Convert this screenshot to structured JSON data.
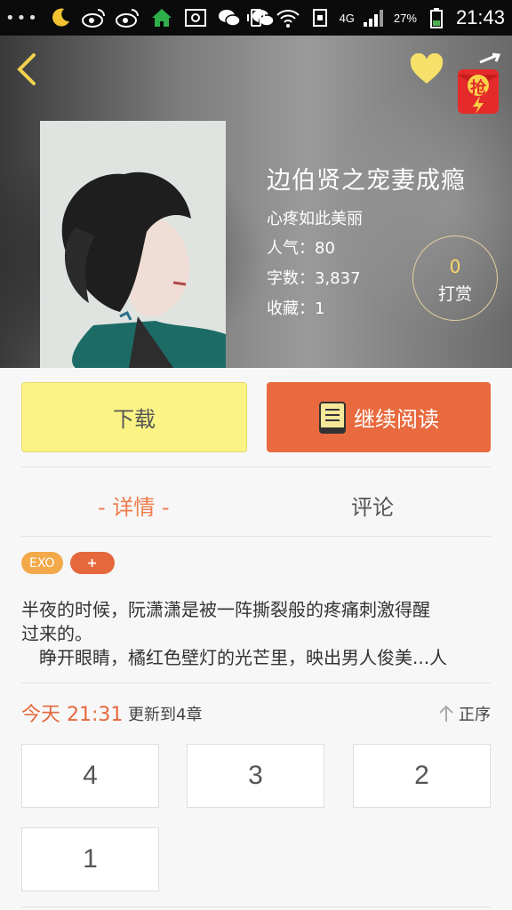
{
  "status_bar": {
    "dots": "•••",
    "network": "4G",
    "battery_percent": "27%",
    "time": "21:43"
  },
  "book": {
    "title": "边伯贤之宠妻成瘾",
    "author": "心疼如此美丽",
    "popularity_label": "人气：",
    "popularity_value": "80",
    "wordcount_label": "字数：",
    "wordcount_value": "3,837",
    "favorites_label": "收藏：",
    "favorites_value": "1"
  },
  "tip": {
    "count": "0",
    "label": "打赏"
  },
  "redpack_label": "抢",
  "actions": {
    "download": "下载",
    "continue_reading": "继续阅读"
  },
  "tabs": {
    "detail": "- 详情 -",
    "comments": "评论"
  },
  "tags": [
    "EXO",
    "+"
  ],
  "synopsis": {
    "line1": "半夜的时候，阮潇潇是被一阵撕裂般的疼痛刺激得醒",
    "line2": "过来的。",
    "line3": "　睁开眼睛，橘红色壁灯的光芒里，映出男人俊美...人"
  },
  "update": {
    "time": "今天 21:31",
    "text": "更新到4章",
    "sort_label": "正序"
  },
  "chapters": [
    "4",
    "3",
    "2",
    "1"
  ],
  "colors": {
    "accent": "#e96a3e",
    "download_bg": "#fbf485",
    "tab_active": "#ee7b4a"
  }
}
